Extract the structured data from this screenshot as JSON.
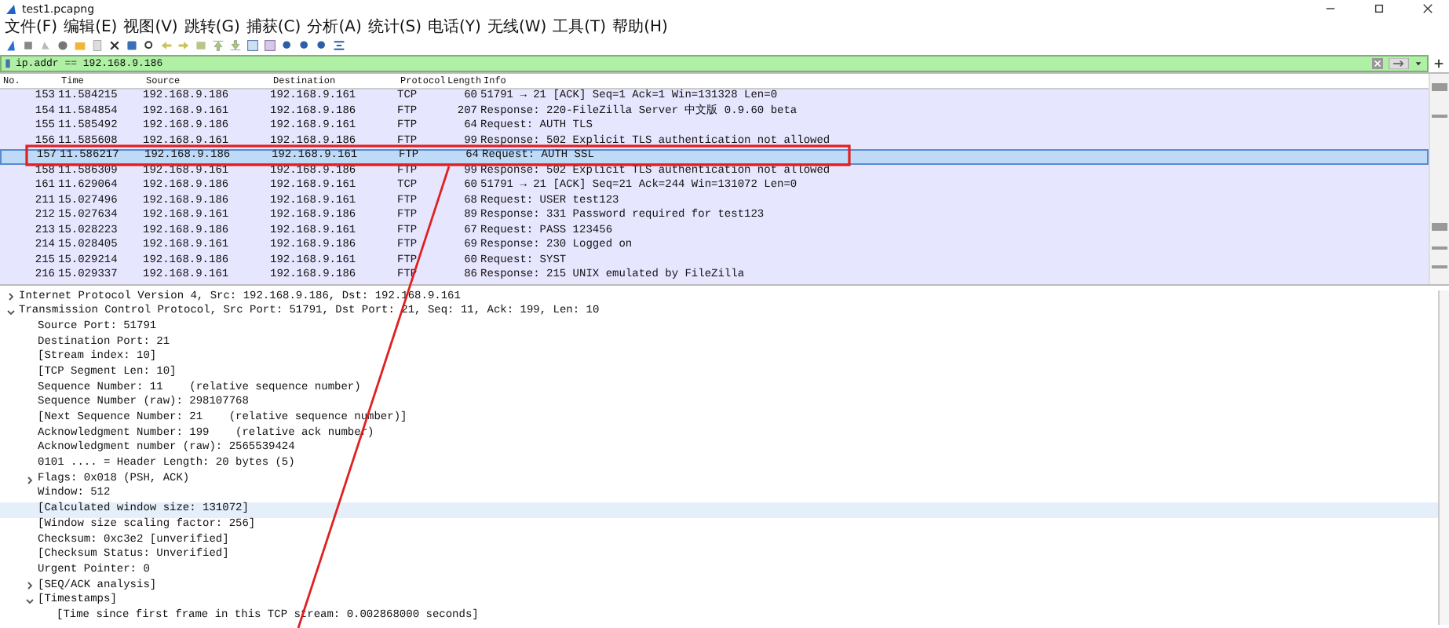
{
  "window": {
    "title": "test1.pcapng"
  },
  "menu": [
    "文件(F)",
    "编辑(E)",
    "视图(V)",
    "跳转(G)",
    "捕获(C)",
    "分析(A)",
    "统计(S)",
    "电话(Y)",
    "无线(W)",
    "工具(T)",
    "帮助(H)"
  ],
  "filter": {
    "value": "ip.addr == 192.168.9.186"
  },
  "packet_list": {
    "columns": [
      "No.",
      "Time",
      "Source",
      "Destination",
      "Protocol",
      "Length",
      "Info"
    ],
    "rows": [
      {
        "no": "153",
        "time": "11.584215",
        "source": "192.168.9.186",
        "destination": "192.168.9.161",
        "protocol": "TCP",
        "length": "60",
        "info": "51791 → 21 [ACK] Seq=1 Ack=1 Win=131328 Len=0",
        "selected": false
      },
      {
        "no": "154",
        "time": "11.584854",
        "source": "192.168.9.161",
        "destination": "192.168.9.186",
        "protocol": "FTP",
        "length": "207",
        "info": "Response: 220-FileZilla Server 中文版 0.9.60 beta",
        "selected": false
      },
      {
        "no": "155",
        "time": "11.585492",
        "source": "192.168.9.186",
        "destination": "192.168.9.161",
        "protocol": "FTP",
        "length": "64",
        "info": "Request: AUTH TLS",
        "selected": false
      },
      {
        "no": "156",
        "time": "11.585608",
        "source": "192.168.9.161",
        "destination": "192.168.9.186",
        "protocol": "FTP",
        "length": "99",
        "info": "Response: 502 Explicit TLS authentication not allowed",
        "selected": false
      },
      {
        "no": "157",
        "time": "11.586217",
        "source": "192.168.9.186",
        "destination": "192.168.9.161",
        "protocol": "FTP",
        "length": "64",
        "info": "Request: AUTH SSL",
        "selected": true
      },
      {
        "no": "158",
        "time": "11.586309",
        "source": "192.168.9.161",
        "destination": "192.168.9.186",
        "protocol": "FTP",
        "length": "99",
        "info": "Response: 502 Explicit TLS authentication not allowed",
        "selected": false
      },
      {
        "no": "161",
        "time": "11.629064",
        "source": "192.168.9.186",
        "destination": "192.168.9.161",
        "protocol": "TCP",
        "length": "60",
        "info": "51791 → 21 [ACK] Seq=21 Ack=244 Win=131072 Len=0",
        "selected": false
      },
      {
        "no": "211",
        "time": "15.027496",
        "source": "192.168.9.186",
        "destination": "192.168.9.161",
        "protocol": "FTP",
        "length": "68",
        "info": "Request: USER test123",
        "selected": false
      },
      {
        "no": "212",
        "time": "15.027634",
        "source": "192.168.9.161",
        "destination": "192.168.9.186",
        "protocol": "FTP",
        "length": "89",
        "info": "Response: 331 Password required for test123",
        "selected": false
      },
      {
        "no": "213",
        "time": "15.028223",
        "source": "192.168.9.186",
        "destination": "192.168.9.161",
        "protocol": "FTP",
        "length": "67",
        "info": "Request: PASS 123456",
        "selected": false
      },
      {
        "no": "214",
        "time": "15.028405",
        "source": "192.168.9.161",
        "destination": "192.168.9.186",
        "protocol": "FTP",
        "length": "69",
        "info": "Response: 230 Logged on",
        "selected": false
      },
      {
        "no": "215",
        "time": "15.029214",
        "source": "192.168.9.186",
        "destination": "192.168.9.161",
        "protocol": "FTP",
        "length": "60",
        "info": "Request: SYST",
        "selected": false
      },
      {
        "no": "216",
        "time": "15.029337",
        "source": "192.168.9.161",
        "destination": "192.168.9.186",
        "protocol": "FTP",
        "length": "86",
        "info": "Response: 215 UNIX emulated by FileZilla",
        "selected": false
      }
    ]
  },
  "details": [
    {
      "kind": "node",
      "text": "Internet Protocol Version 4, Src: 192.168.9.186, Dst: 192.168.9.161",
      "expanded": false,
      "selected": false
    },
    {
      "kind": "node",
      "text": "Transmission Control Protocol, Src Port: 51791, Dst Port: 21, Seq: 11, Ack: 199, Len: 10",
      "expanded": true,
      "selected": false,
      "children": [
        {
          "kind": "leaf",
          "text": "Source Port: 51791",
          "selected": false
        },
        {
          "kind": "leaf",
          "text": "Destination Port: 21",
          "selected": false
        },
        {
          "kind": "leaf",
          "text": "[Stream index: 10]",
          "selected": false
        },
        {
          "kind": "leaf",
          "text": "[TCP Segment Len: 10]",
          "selected": false
        },
        {
          "kind": "leaf",
          "text": "Sequence Number: 11    (relative sequence number)",
          "selected": false
        },
        {
          "kind": "leaf",
          "text": "Sequence Number (raw): 298107768",
          "selected": false
        },
        {
          "kind": "leaf",
          "text": "[Next Sequence Number: 21    (relative sequence number)]",
          "selected": false
        },
        {
          "kind": "leaf",
          "text": "Acknowledgment Number: 199    (relative ack number)",
          "selected": false
        },
        {
          "kind": "leaf",
          "text": "Acknowledgment number (raw): 2565539424",
          "selected": false
        },
        {
          "kind": "leaf",
          "text": "0101 .... = Header Length: 20 bytes (5)",
          "selected": false
        },
        {
          "kind": "node",
          "text": "Flags: 0x018 (PSH, ACK)",
          "expanded": false,
          "selected": false
        },
        {
          "kind": "leaf",
          "text": "Window: 512",
          "selected": false
        },
        {
          "kind": "leaf",
          "text": "[Calculated window size: 131072]",
          "selected": true
        },
        {
          "kind": "leaf",
          "text": "[Window size scaling factor: 256]",
          "selected": false
        },
        {
          "kind": "leaf",
          "text": "Checksum: 0xc3e2 [unverified]",
          "selected": false
        },
        {
          "kind": "leaf",
          "text": "[Checksum Status: Unverified]",
          "selected": false
        },
        {
          "kind": "leaf",
          "text": "Urgent Pointer: 0",
          "selected": false
        },
        {
          "kind": "node",
          "text": "[SEQ/ACK analysis]",
          "expanded": false,
          "selected": false
        },
        {
          "kind": "node",
          "text": "[Timestamps]",
          "expanded": true,
          "selected": false,
          "children": [
            {
              "kind": "leaf",
              "text": "[Time since first frame in this TCP stream: 0.002868000 seconds]",
              "selected": false
            }
          ]
        }
      ]
    }
  ]
}
